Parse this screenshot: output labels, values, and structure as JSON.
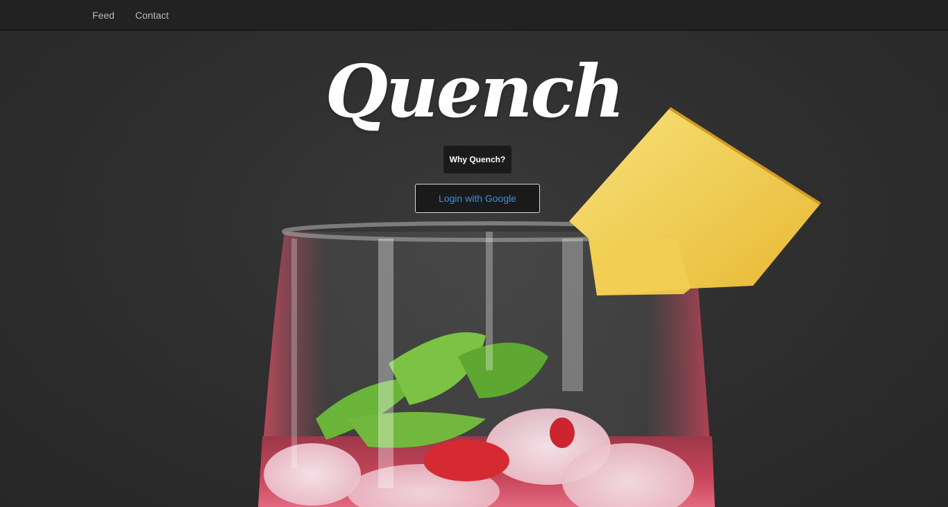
{
  "nav": {
    "items": [
      {
        "label": "Feed"
      },
      {
        "label": "Contact"
      }
    ]
  },
  "hero": {
    "brand_title": "Quench",
    "why_button_label": "Why Quench?",
    "login_button_label": "Login with Google",
    "image_subject": "pink cocktail glass with ice, mint leaves, strawberry and pineapple garnish"
  },
  "colors": {
    "navbar_bg": "#222222",
    "nav_text": "#b8b8b8",
    "hero_bg": "#2f2f2f",
    "login_text": "#3b8fe0",
    "why_button_bg": "#1b1b1b"
  }
}
